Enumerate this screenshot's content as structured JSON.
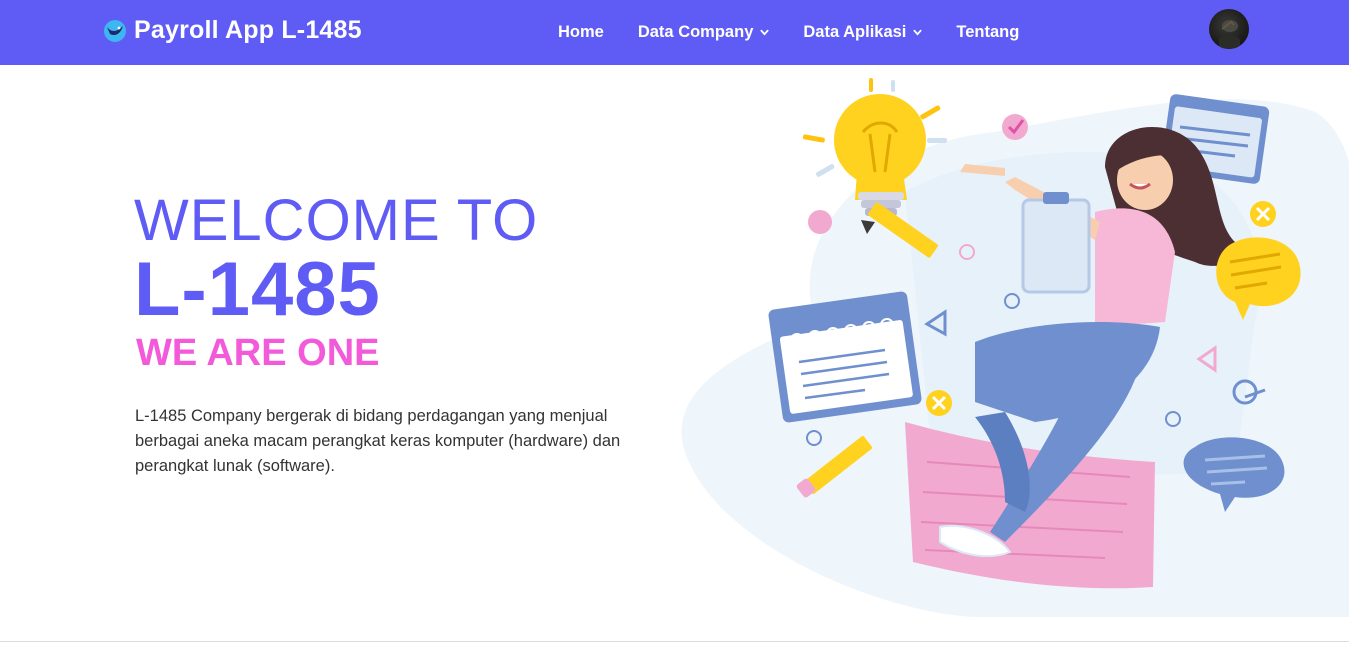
{
  "navbar": {
    "brand": "Payroll App L-1485",
    "items": [
      {
        "label": "Home",
        "dropdown": false
      },
      {
        "label": "Data Company",
        "dropdown": true
      },
      {
        "label": "Data Aplikasi",
        "dropdown": true
      },
      {
        "label": "Tentang",
        "dropdown": false
      }
    ],
    "icons": {
      "logo": "bird-logo-icon",
      "dropdown": "chevron-down-icon",
      "avatar": "user-avatar"
    }
  },
  "hero": {
    "welcome": "WELCOME TO",
    "title": "L-1485",
    "tagline": "WE ARE ONE",
    "description": "L-1485 Company bergerak di bidang perdagangan yang menjual berbagai aneka macam perangkat keras komputer (hardware) dan perangkat lunak (software)."
  },
  "colors": {
    "primary": "#5f5cf5",
    "accent": "#f25ad9",
    "illustration_blue": "#6f8fcf",
    "illustration_pink": "#f2a9cf",
    "illustration_yellow": "#ffd21f"
  }
}
